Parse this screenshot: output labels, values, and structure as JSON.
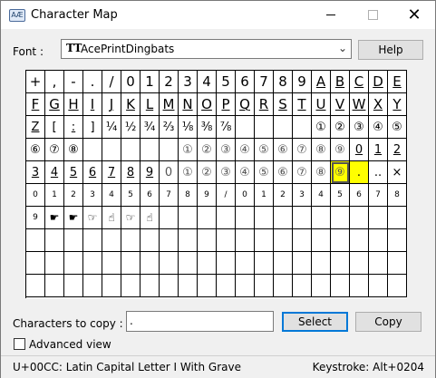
{
  "window": {
    "title": "Character Map",
    "icon_text": "AÆ"
  },
  "font": {
    "label": "Font :",
    "value": "AcePrintDingbats",
    "icon": "truetype-icon"
  },
  "buttons": {
    "help": "Help",
    "select": "Select",
    "copy": "Copy"
  },
  "copy": {
    "label": "Characters to copy :",
    "value": "."
  },
  "advanced_view": {
    "label": "Advanced view",
    "checked": false
  },
  "status": {
    "text": "U+00CC: Latin Capital Letter I With Grave",
    "keystroke": "Keystroke: Alt+0204"
  },
  "highlight_color": "#ffff00",
  "grid": {
    "rows": [
      [
        "+",
        ",",
        "-",
        ".",
        "/",
        "0",
        "1",
        "2",
        "3",
        "4",
        "5",
        "6",
        "7",
        "8",
        "9",
        "A",
        "B",
        "C",
        "D",
        "E"
      ],
      [
        "F",
        "G",
        "H",
        "I",
        "J",
        "K",
        "L",
        "M",
        "N",
        "O",
        "P",
        "Q",
        "R",
        "S",
        "T",
        "U",
        "V",
        "W",
        "X",
        "Y"
      ],
      [
        "Z",
        "[",
        ":",
        "]",
        "¼",
        "½",
        "¾",
        "⅔",
        "⅛",
        "⅜",
        "⅞",
        "",
        "",
        "",
        "",
        "①",
        "②",
        "③",
        "④",
        "⑤"
      ],
      [
        "⑥",
        "⑦",
        "⑧",
        "",
        "",
        "",
        "",
        "",
        "①",
        "②",
        "③",
        "④",
        "⑤",
        "⑥",
        "⑦",
        "⑧",
        "⑨",
        "0",
        "1",
        "2"
      ],
      [
        "3",
        "4",
        "5",
        "6",
        "7",
        "8",
        "9",
        "0",
        "①",
        "②",
        "③",
        "④",
        "⑤",
        "⑥",
        "⑦",
        "⑧",
        "⑨",
        ".",
        "..",
        "×"
      ],
      [
        "0",
        "1",
        "2",
        "3",
        "4",
        "5",
        "6",
        "7",
        "8",
        "9",
        "/",
        "0",
        "1",
        "2",
        "3",
        "4",
        "5",
        "6",
        "7",
        "8"
      ],
      [
        "9",
        "☛",
        "☛",
        "☞",
        "☝",
        "☞",
        "☝",
        "",
        "",
        "",
        "",
        "",
        "",
        "",
        "",
        "",
        "",
        "",
        "",
        ""
      ],
      [
        "",
        "",
        "",
        "",
        "",
        "",
        "",
        "",
        "",
        "",
        "",
        "",
        "",
        "",
        "",
        "",
        "",
        "",
        "",
        ""
      ],
      [
        "",
        "",
        "",
        "",
        "",
        "",
        "",
        "",
        "",
        "",
        "",
        "",
        "",
        "",
        "",
        "",
        "",
        "",
        "",
        ""
      ],
      [
        "",
        "",
        "",
        "",
        "",
        "",
        "",
        "",
        "",
        "",
        "",
        "",
        "",
        "",
        "",
        "",
        "",
        "",
        "",
        ""
      ]
    ]
  }
}
